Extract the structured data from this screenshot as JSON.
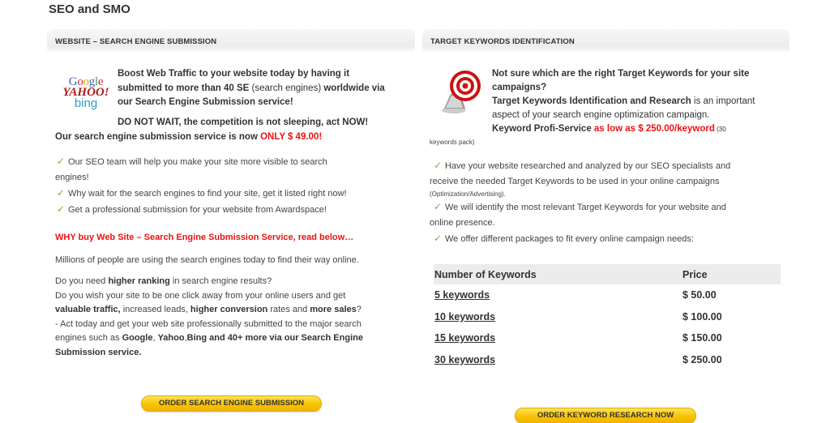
{
  "page": {
    "title": "SEO and SMO"
  },
  "left": {
    "header": "WEBSITE – SEARCH ENGINE SUBMISSION",
    "logos": {
      "google": "Google",
      "yahoo": "YAHOO!",
      "bing": "bing"
    },
    "intro_bold1": "Boost Web Traffic to your website today by having it",
    "intro_line2_a": "submitted to more than 40 SE",
    "intro_line2_b": " (search engines) ",
    "intro_line2_c": "worldwide via",
    "intro_line3": "our Search Engine Submission service!",
    "dont_wait": "DO NOT WAIT, the competition is not sleeping, act NOW!",
    "price_text": "Our search engine submission service is now ",
    "price_value": "ONLY $ 49.00!",
    "bullets": [
      "Our SEO team will help you make your site more visible to search",
      "engines!",
      "Why wait for the search engines to find your site, get it listed right now!",
      "Get a professional submission for your website from Awardspace!"
    ],
    "why_heading": "WHY buy Web Site – Search Engine Submission Service, read below…",
    "millions": "Millions of people are using the search engines today to find their way online.",
    "p_need_a": "Do you need ",
    "p_need_b": "higher ranking",
    "p_need_c": " in search engine results?",
    "p_wish": "Do you wish your site to be one click away from your online users and get",
    "p_val_a": "valuable traffic,",
    "p_val_b": " increased leads, ",
    "p_val_c": "higher conversion",
    "p_val_d": " rates and ",
    "p_val_e": "more sales",
    "p_val_f": "?",
    "p_act": "- Act today and get your web site professionally submitted to the major search",
    "p_engines_a": "engines such as ",
    "p_engines_b": "Google",
    "p_engines_c": ", ",
    "p_engines_d": "Yahoo",
    "p_engines_e": ",",
    "p_engines_f": "Bing and 40+ more via our Search Engine",
    "p_engines_g": "Submission service.",
    "button": "ORDER SEARCH ENGINE SUBMISSION"
  },
  "right": {
    "header": "TARGET KEYWORDS IDENTIFICATION",
    "q1": "Not sure which are the right Target Keywords for your site",
    "q2": "campaigns?",
    "tk_bold": "Target Keywords Identification and Research",
    "tk_rest": " is an important",
    "aspect": "aspect of your search engine optimization campaign.",
    "profi_bold": "Keyword Profi-Service",
    "profi_red": " as low as $ 250.00/keyword",
    "profi_small": " (30",
    "pack": "keywords pack)",
    "b1_l1": "Have your website researched and analyzed by our SEO specialists and",
    "b1_l2": "receive the needed Target Keywords to be used in your online campaigns",
    "b1_l3": "(Optimization/Advertising).",
    "b2_l1": "We will identify the most relevant Target Keywords for your website and",
    "b2_l2": "online presence.",
    "b3_l1": "We offer different packages to fit every online campaign needs:",
    "table_headers": [
      "Number of Keywords",
      "Price"
    ],
    "table_rows": [
      {
        "keywords": "5 keywords",
        "price": "$ 50.00"
      },
      {
        "keywords": "10 keywords",
        "price": "$ 100.00"
      },
      {
        "keywords": "15 keywords",
        "price": "$ 150.00"
      },
      {
        "keywords": "30 keywords",
        "price": "$ 250.00"
      }
    ],
    "button": "ORDER KEYWORD RESEARCH NOW"
  },
  "colors": {
    "accent_red": "#ee1111",
    "check_green": "#6ab83e",
    "button_yellow": "#f8c400"
  },
  "icons": {
    "bullet": "checkmark-icon",
    "target": "target-icon"
  }
}
